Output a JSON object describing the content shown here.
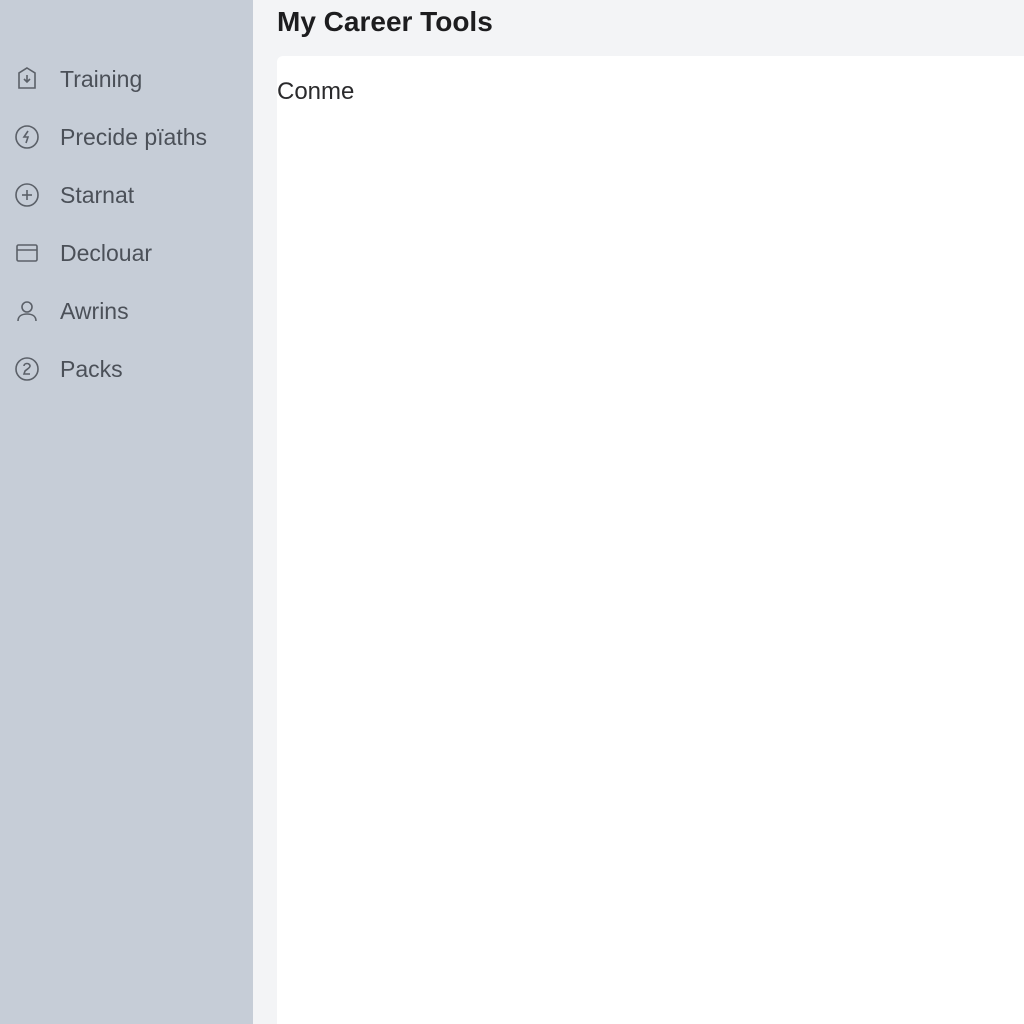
{
  "header": {
    "title": "My Career Tools"
  },
  "content": {
    "text": "Conme"
  },
  "sidebar": {
    "items": [
      {
        "label": "Training",
        "icon": "download-box-icon"
      },
      {
        "label": "Precide pïaths",
        "icon": "lightning-circle-icon"
      },
      {
        "label": "Starnat",
        "icon": "plus-circle-icon"
      },
      {
        "label": "Declouar",
        "icon": "browser-icon"
      },
      {
        "label": "Awrins",
        "icon": "person-icon"
      },
      {
        "label": "Packs",
        "icon": "two-circle-icon"
      }
    ]
  }
}
